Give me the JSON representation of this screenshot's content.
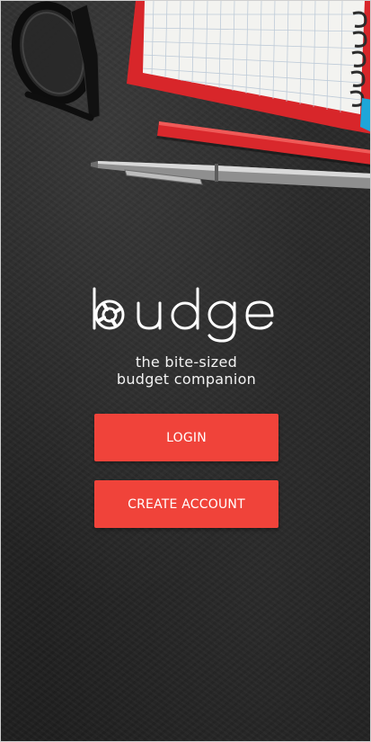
{
  "app": {
    "name": "budge",
    "tagline_line1": "the bite-sized",
    "tagline_line2": "budget companion"
  },
  "actions": {
    "login_label": "LOGIN",
    "create_account_label": "CREATE ACCOUNT"
  },
  "colors": {
    "accent": "#f0433a",
    "background": "#262626",
    "text": "#ffffff"
  },
  "icons": {
    "logo_mark": "budge-logo-mark"
  }
}
